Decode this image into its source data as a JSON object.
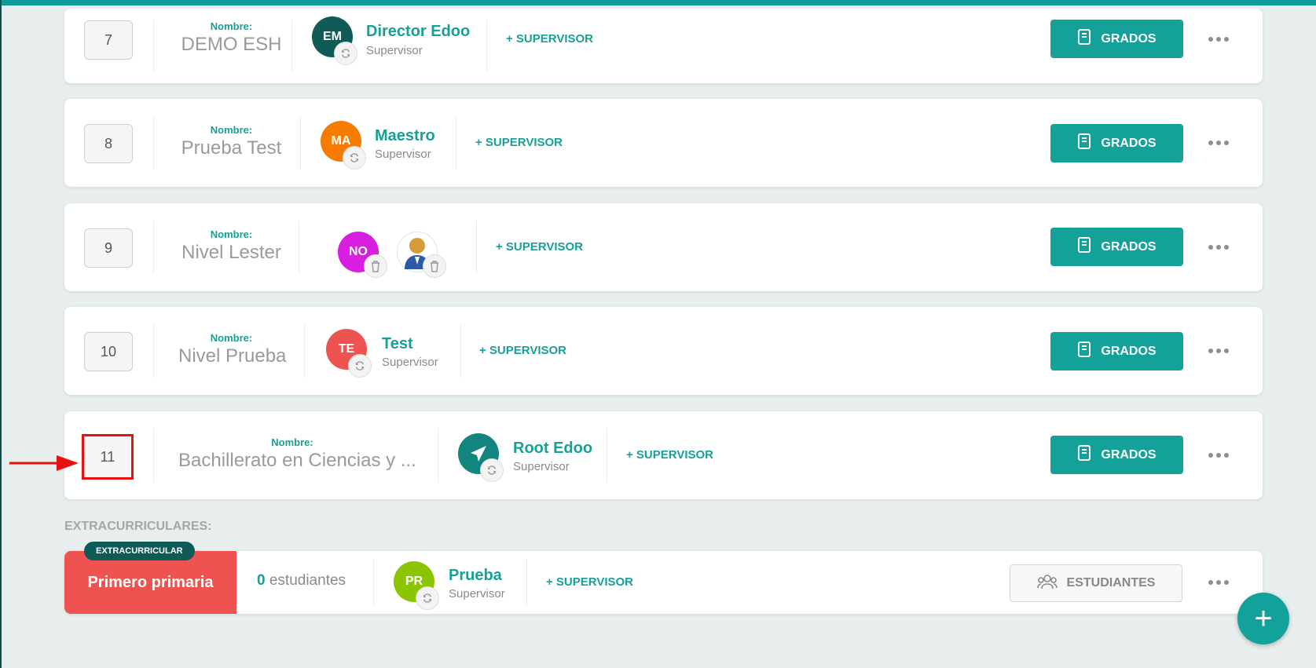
{
  "levels": [
    {
      "order": "7",
      "name_label": "Nombre:",
      "name": "DEMO ESH",
      "avatar_initials": "EM",
      "avatar_color": "#0e5c55",
      "person": "Director Edoo",
      "role": "Supervisor"
    },
    {
      "order": "8",
      "name_label": "Nombre:",
      "name": "Prueba Test",
      "avatar_initials": "MA",
      "avatar_color": "#f57c00",
      "person": "Maestro",
      "role": "Supervisor"
    },
    {
      "order": "9",
      "name_label": "Nombre:",
      "name": "Nivel Lester",
      "avatar_initials": "NO",
      "avatar_color": "#d81ee0"
    },
    {
      "order": "10",
      "name_label": "Nombre:",
      "name": "Nivel Prueba",
      "avatar_initials": "TE",
      "avatar_color": "#ef5350",
      "person": "Test",
      "role": "Supervisor"
    },
    {
      "order": "11",
      "name_label": "Nombre:",
      "name": "Bachillerato en Ciencias y ...",
      "avatar_color": "#12857e",
      "person": "Root Edoo",
      "role": "Supervisor"
    }
  ],
  "add_supervisor_label": "+ SUPERVISOR",
  "grados_label": "GRADOS",
  "section_extracurricular": "EXTRACURRICULARES:",
  "extra": {
    "tag": "EXTRACURRICULAR",
    "title": "Primero primaria",
    "count": "0",
    "count_label": "estudiantes",
    "avatar_initials": "PR",
    "avatar_color": "#8bc400",
    "person": "Prueba",
    "role": "Supervisor",
    "students_label": "ESTUDIANTES"
  },
  "fab_label": "+",
  "icons": {
    "sync": "sync-icon",
    "trash": "trash-icon",
    "book": "book-icon",
    "more": "more-icon",
    "group": "group-icon",
    "plane": "paper-plane-icon",
    "user": "user-avatar-icon"
  }
}
